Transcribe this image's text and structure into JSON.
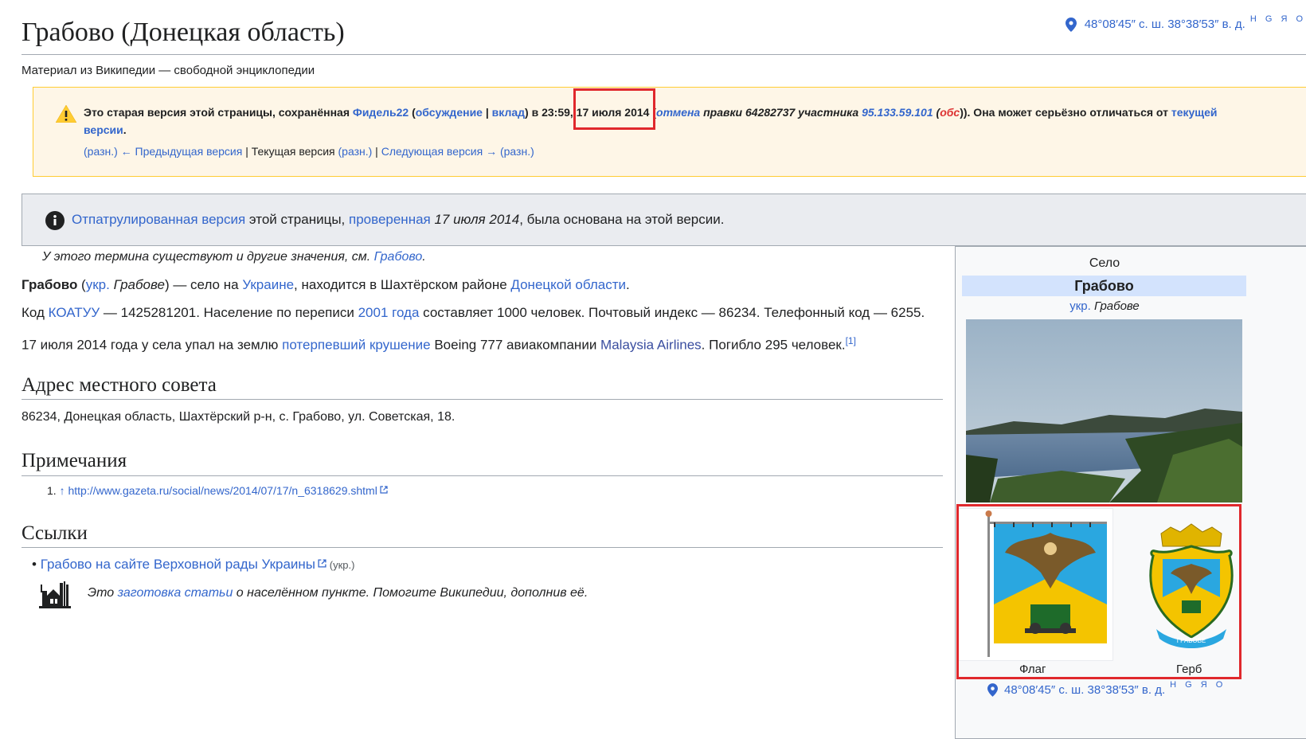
{
  "header": {
    "title": "Грабово (Донецкая область)",
    "subtitle": "Материал из Википедии — свободной энциклопедии",
    "coords": "48°08′45″ с. ш. 38°38′53″ в. д.",
    "coord_letters": "H G Я O"
  },
  "revision_notice": {
    "t1": "Это старая версия этой страницы, сохранённая ",
    "user": "Фидель22",
    "paren_open": " (",
    "talk": "обсуждение",
    "sep": " | ",
    "contrib": "вклад",
    "t2": ") в 23:59, ",
    "date": "17 июля 2014",
    "t3": " (",
    "undo": "отмена",
    "t4": " правки 64282737 участника ",
    "ip": "95.133.59.101",
    "t5": " (",
    "obs": "обс",
    "t6": ")). Она может серьёзно отличаться от ",
    "current": "текущей версии",
    "t7": ".",
    "nav": {
      "diff1": "(разн.)",
      "prev": "← Предыдущая версия",
      "bar1": " | ",
      "current": "Текущая версия",
      "diff2": " (разн.)",
      "bar2": " | ",
      "next": "Следующая версия →",
      "diff3": " (разн.)"
    }
  },
  "patrolled": {
    "link1": "Отпатрулированная версия",
    "t1": " этой страницы, ",
    "link2": "проверенная",
    "date": " 17 июля 2014",
    "t2": ", была основана на этой версии."
  },
  "content": {
    "hatnote_text": "У этого термина существуют и другие значения, см. ",
    "hatnote_link": "Грабово",
    "hatnote_end": ".",
    "p1": {
      "bold": "Грабово",
      "t1": " (",
      "ukr": "укр.",
      "t2": " Грабове",
      "t3": ") — село на ",
      "ukraine": "Украине",
      "t4": ", находится в Шахтёрском районе ",
      "oblast": "Донецкой области",
      "t5": "."
    },
    "p2": {
      "t1": "Код ",
      "koatuu": "КОАТУУ",
      "t2": " — 1425281201. Население по переписи ",
      "census": "2001 года",
      "t3": " составляет 1000 человек. Почтовый индекс — 86234. Телефонный код — 6255."
    },
    "p3": {
      "t1": "17 июля 2014 года у села упал на землю ",
      "crash": "потерпевший крушение",
      "t2": " Boeing 777 авиакомпании ",
      "airline": "Malaysia Airlines",
      "t3": ". Погибло 295 человек.",
      "ref": "[1]"
    },
    "sections": {
      "address": "Адрес местного совета",
      "address_text": "86234, Донецкая область, Шахтёрский р-н, с. Грабово, ул. Советская, 18.",
      "notes": "Примечания",
      "note1_num": "1.",
      "note1_arrow": "↑",
      "note1_url": "http://www.gazeta.ru/social/news/2014/07/17/n_6318629.shtml",
      "links": "Ссылки",
      "link1": "Грабово на сайте Верховной рады Украины",
      "link1_lang": "(укр.)",
      "stub_t1": "Это ",
      "stub_link": "заготовка статьи",
      "stub_t2": " о населённом пункте. Помогите Википедии, дополнив её."
    }
  },
  "infobox": {
    "type": "Село",
    "name": "Грабово",
    "ukr": "укр.",
    "name_uk": " Грабове",
    "flag_label": "Флаг",
    "coat_label": "Герб",
    "coat_ribbon": "ГРАБОВЕ",
    "coords": "48°08′45″ с. ш. 38°38′53″ в. д.",
    "coord_letters": "H G Я O"
  },
  "colors": {
    "link": "#3366cc",
    "highlight": "#e0282c",
    "warning_bg": "#fef6e7",
    "warning_border": "#ffcc33",
    "notice_bg": "#eaecf0"
  }
}
